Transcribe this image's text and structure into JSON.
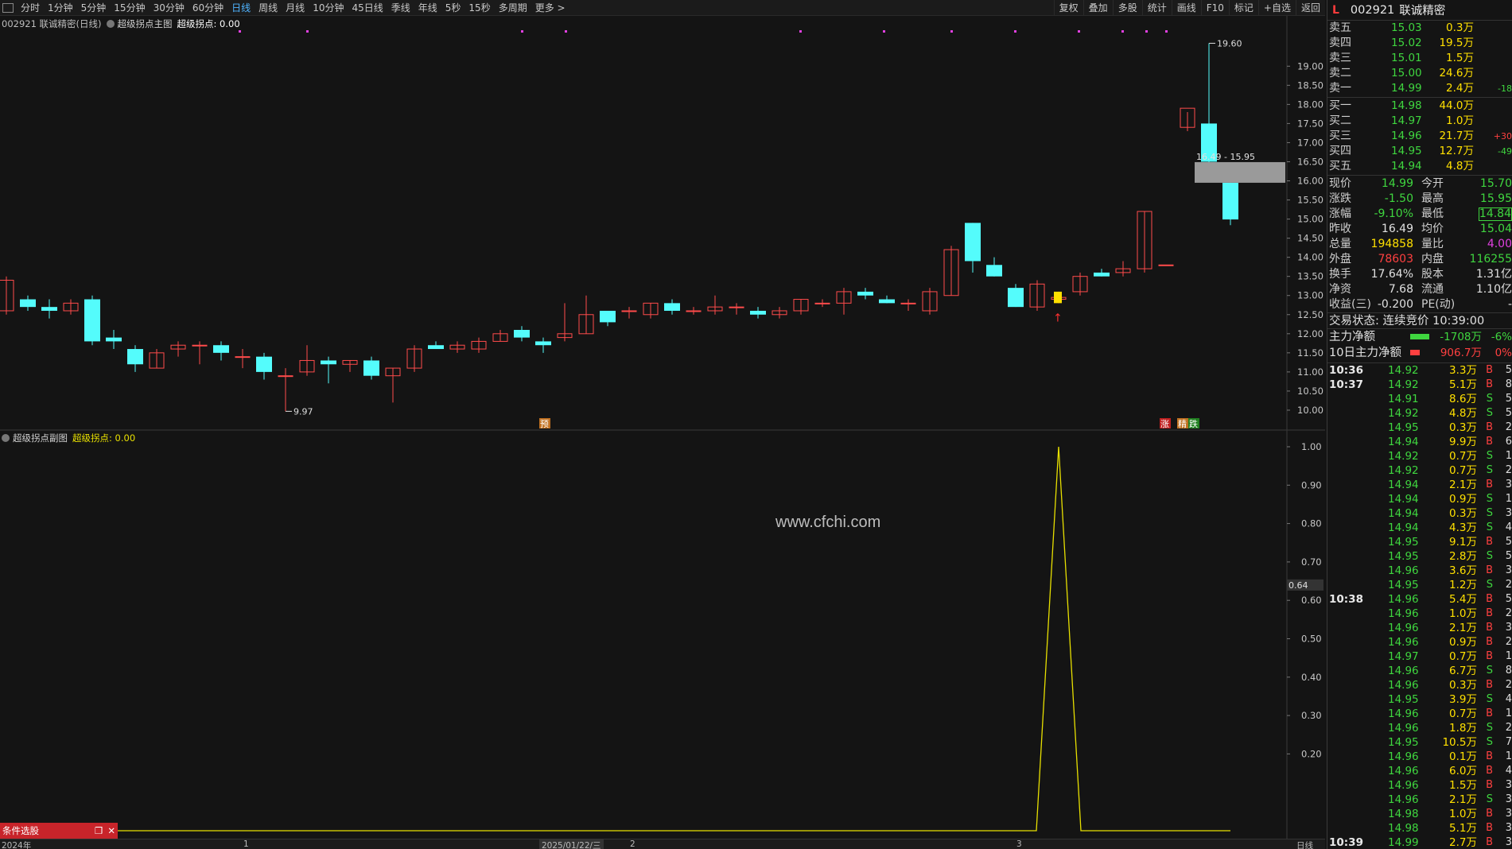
{
  "toolbar": {
    "periods": [
      "分时",
      "1分钟",
      "5分钟",
      "15分钟",
      "30分钟",
      "60分钟",
      "日线",
      "周线",
      "月线",
      "10分钟",
      "45日线",
      "季线",
      "年线",
      "5秒",
      "15秒",
      "多周期",
      "更多 >"
    ],
    "active_index": 6,
    "tools": [
      "复权",
      "叠加",
      "多股",
      "统计",
      "画线",
      "F10",
      "标记",
      "+自选",
      "返回"
    ]
  },
  "main": {
    "stock_label": "002921 联诚精密(日线)",
    "indicator_name": "超级拐点主图",
    "indicator_label": "超级拐点: 0.00",
    "price_axis": [
      "19.00",
      "18.50",
      "18.00",
      "17.50",
      "17.00",
      "16.50",
      "16.00",
      "15.50",
      "15.00",
      "14.50",
      "14.00",
      "13.50",
      "13.00",
      "12.50",
      "12.00",
      "11.50",
      "11.00",
      "10.50",
      "10.00"
    ],
    "high_label": "19.60",
    "low_label": "9.97",
    "gap_label": "16.49 - 15.95",
    "markers": [
      "预",
      "涨",
      "跌"
    ],
    "buy_marker": "精"
  },
  "sub": {
    "indicator_name": "超级拐点副图",
    "indicator_label": "超级拐点: 0.00",
    "axis": [
      "1.00",
      "0.90",
      "0.80",
      "0.70",
      "0.60",
      "0.50",
      "0.40",
      "0.30",
      "0.20"
    ],
    "cursor_value": "0.64"
  },
  "watermark": "www.cfchi.com",
  "condition_tab": "条件选股",
  "bottom_axis": {
    "year": "2024年",
    "m1": "1",
    "date": "2025/01/22/三",
    "m2": "2",
    "m3": "3",
    "period": "日线"
  },
  "chart_data": {
    "type": "candlestick",
    "ylim": [
      9.5,
      19.9
    ],
    "candles": [
      [
        12.6,
        13.5,
        12.5,
        13.4
      ],
      [
        12.9,
        13.0,
        12.6,
        12.7
      ],
      [
        12.7,
        12.9,
        12.4,
        12.6
      ],
      [
        12.6,
        12.9,
        12.5,
        12.8
      ],
      [
        12.9,
        13.0,
        11.7,
        11.8
      ],
      [
        11.9,
        12.1,
        11.6,
        11.8
      ],
      [
        11.6,
        11.7,
        11.0,
        11.2
      ],
      [
        11.1,
        11.6,
        11.1,
        11.5
      ],
      [
        11.6,
        11.8,
        11.4,
        11.7
      ],
      [
        11.7,
        11.8,
        11.2,
        11.7
      ],
      [
        11.7,
        11.8,
        11.3,
        11.5
      ],
      [
        11.4,
        11.6,
        11.1,
        11.4
      ],
      [
        11.4,
        11.5,
        10.8,
        11.0
      ],
      [
        10.9,
        11.1,
        9.97,
        10.9
      ],
      [
        11.0,
        11.7,
        10.9,
        11.3
      ],
      [
        11.3,
        11.4,
        10.7,
        11.2
      ],
      [
        11.2,
        11.3,
        11.0,
        11.3
      ],
      [
        11.3,
        11.4,
        10.8,
        10.9
      ],
      [
        10.9,
        11.1,
        10.2,
        11.1
      ],
      [
        11.1,
        11.7,
        11.0,
        11.6
      ],
      [
        11.7,
        11.8,
        11.6,
        11.6
      ],
      [
        11.6,
        11.8,
        11.5,
        11.7
      ],
      [
        11.6,
        11.9,
        11.5,
        11.8
      ],
      [
        11.8,
        12.1,
        11.8,
        12.0
      ],
      [
        12.1,
        12.2,
        11.8,
        11.9
      ],
      [
        11.8,
        11.9,
        11.5,
        11.7
      ],
      [
        11.9,
        12.8,
        11.8,
        12.0
      ],
      [
        12.0,
        13.0,
        12.0,
        12.5
      ],
      [
        12.6,
        12.6,
        12.2,
        12.3
      ],
      [
        12.6,
        12.7,
        12.4,
        12.6
      ],
      [
        12.5,
        12.8,
        12.4,
        12.8
      ],
      [
        12.8,
        12.9,
        12.5,
        12.6
      ],
      [
        12.6,
        12.7,
        12.5,
        12.6
      ],
      [
        12.6,
        13.0,
        12.5,
        12.7
      ],
      [
        12.7,
        12.8,
        12.5,
        12.7
      ],
      [
        12.6,
        12.7,
        12.4,
        12.5
      ],
      [
        12.5,
        12.7,
        12.4,
        12.6
      ],
      [
        12.6,
        12.9,
        12.5,
        12.9
      ],
      [
        12.8,
        12.9,
        12.7,
        12.8
      ],
      [
        12.8,
        13.2,
        12.5,
        13.1
      ],
      [
        13.1,
        13.2,
        12.9,
        13.0
      ],
      [
        12.9,
        13.0,
        12.8,
        12.8
      ],
      [
        12.8,
        12.9,
        12.6,
        12.8
      ],
      [
        12.6,
        13.2,
        12.5,
        13.1
      ],
      [
        13.0,
        14.3,
        13.0,
        14.2
      ],
      [
        14.9,
        14.9,
        13.6,
        13.9
      ],
      [
        13.8,
        14.0,
        13.5,
        13.5
      ],
      [
        13.2,
        13.3,
        12.7,
        12.7
      ],
      [
        12.7,
        13.4,
        12.6,
        13.3
      ],
      [
        12.9,
        13.1,
        12.8,
        12.95
      ],
      [
        13.1,
        13.6,
        13.0,
        13.5
      ],
      [
        13.6,
        13.7,
        13.5,
        13.5
      ],
      [
        13.6,
        13.9,
        13.5,
        13.7
      ],
      [
        13.7,
        15.2,
        13.6,
        15.2
      ],
      [
        13.8,
        13.8,
        13.8,
        13.8
      ],
      [
        17.4,
        17.8,
        17.3,
        17.9
      ],
      [
        17.5,
        19.6,
        16.4,
        16.5
      ],
      [
        15.95,
        15.95,
        14.84,
        14.99
      ]
    ]
  },
  "panel": {
    "code": "002921",
    "name": "联诚精密",
    "flag": "L",
    "asks": [
      {
        "label": "卖五",
        "price": "15.03",
        "vol": "0.3万",
        "chg": ""
      },
      {
        "label": "卖四",
        "price": "15.02",
        "vol": "19.5万",
        "chg": ""
      },
      {
        "label": "卖三",
        "price": "15.01",
        "vol": "1.5万",
        "chg": ""
      },
      {
        "label": "卖二",
        "price": "15.00",
        "vol": "24.6万",
        "chg": ""
      },
      {
        "label": "卖一",
        "price": "14.99",
        "vol": "2.4万",
        "chg": "-18"
      }
    ],
    "bids": [
      {
        "label": "买一",
        "price": "14.98",
        "vol": "44.0万",
        "chg": ""
      },
      {
        "label": "买二",
        "price": "14.97",
        "vol": "1.0万",
        "chg": ""
      },
      {
        "label": "买三",
        "price": "14.96",
        "vol": "21.7万",
        "chg": "+30"
      },
      {
        "label": "买四",
        "price": "14.95",
        "vol": "12.7万",
        "chg": "-49"
      },
      {
        "label": "买五",
        "price": "14.94",
        "vol": "4.8万",
        "chg": ""
      }
    ],
    "quote": [
      {
        "a": "现价",
        "av": "14.99",
        "ac": "#3fd63f",
        "b": "今开",
        "bv": "15.70",
        "bc": "#3fd63f"
      },
      {
        "a": "涨跌",
        "av": "-1.50",
        "ac": "#3fd63f",
        "b": "最高",
        "bv": "15.95",
        "bc": "#3fd63f"
      },
      {
        "a": "涨幅",
        "av": "-9.10%",
        "ac": "#3fd63f",
        "b": "最低",
        "bv": "14.84",
        "bc": "#3fd63f"
      },
      {
        "a": "昨收",
        "av": "16.49",
        "ac": "#e0e0e0",
        "b": "均价",
        "bv": "15.04",
        "bc": "#3fd63f"
      },
      {
        "a": "总量",
        "av": "194858",
        "ac": "#ffe000",
        "b": "量比",
        "bv": "4.00",
        "bc": "#e040e0"
      },
      {
        "a": "外盘",
        "av": "78603",
        "ac": "#ff4040",
        "b": "内盘",
        "bv": "116255",
        "bc": "#3fd63f"
      },
      {
        "a": "换手",
        "av": "17.64%",
        "ac": "#e0e0e0",
        "b": "股本",
        "bv": "1.31亿",
        "bc": "#e0e0e0"
      },
      {
        "a": "净资",
        "av": "7.68",
        "ac": "#e0e0e0",
        "b": "流通",
        "bv": "1.10亿",
        "bc": "#e0e0e0"
      },
      {
        "a": "收益(三)",
        "av": "-0.200",
        "ac": "#e0e0e0",
        "b": "PE(动)",
        "bv": "-",
        "bc": "#e0e0e0"
      }
    ],
    "status": "交易状态: 连续竞价 10:39:00",
    "flow1": {
      "label": "主力净额",
      "value": "-1708万",
      "pct": "-6%",
      "color": "#3fd63f"
    },
    "flow2": {
      "label": "10日主力净额",
      "value": "906.7万",
      "pct": "0%",
      "color": "#ff4040"
    },
    "ticks": [
      {
        "t": "10:36",
        "p": "14.92",
        "v": "3.3万",
        "bs": "B",
        "n": "5"
      },
      {
        "t": "10:37",
        "p": "14.92",
        "v": "5.1万",
        "bs": "B",
        "n": "8"
      },
      {
        "t": "",
        "p": "14.91",
        "v": "8.6万",
        "bs": "S",
        "n": "5"
      },
      {
        "t": "",
        "p": "14.92",
        "v": "4.8万",
        "bs": "S",
        "n": "5"
      },
      {
        "t": "",
        "p": "14.95",
        "v": "0.3万",
        "bs": "B",
        "n": "2"
      },
      {
        "t": "",
        "p": "14.94",
        "v": "9.9万",
        "bs": "B",
        "n": "6"
      },
      {
        "t": "",
        "p": "14.92",
        "v": "0.7万",
        "bs": "S",
        "n": "1"
      },
      {
        "t": "",
        "p": "14.92",
        "v": "0.7万",
        "bs": "S",
        "n": "2"
      },
      {
        "t": "",
        "p": "14.94",
        "v": "2.1万",
        "bs": "B",
        "n": "3"
      },
      {
        "t": "",
        "p": "14.94",
        "v": "0.9万",
        "bs": "S",
        "n": "1"
      },
      {
        "t": "",
        "p": "14.94",
        "v": "0.3万",
        "bs": "S",
        "n": "3"
      },
      {
        "t": "",
        "p": "14.94",
        "v": "4.3万",
        "bs": "S",
        "n": "4"
      },
      {
        "t": "",
        "p": "14.95",
        "v": "9.1万",
        "bs": "B",
        "n": "5"
      },
      {
        "t": "",
        "p": "14.95",
        "v": "2.8万",
        "bs": "S",
        "n": "5"
      },
      {
        "t": "",
        "p": "14.96",
        "v": "3.6万",
        "bs": "B",
        "n": "3"
      },
      {
        "t": "",
        "p": "14.95",
        "v": "1.2万",
        "bs": "S",
        "n": "2"
      },
      {
        "t": "10:38",
        "p": "14.96",
        "v": "5.4万",
        "bs": "B",
        "n": "5"
      },
      {
        "t": "",
        "p": "14.96",
        "v": "1.0万",
        "bs": "B",
        "n": "2"
      },
      {
        "t": "",
        "p": "14.96",
        "v": "2.1万",
        "bs": "B",
        "n": "3"
      },
      {
        "t": "",
        "p": "14.96",
        "v": "0.9万",
        "bs": "B",
        "n": "2"
      },
      {
        "t": "",
        "p": "14.97",
        "v": "0.7万",
        "bs": "B",
        "n": "1"
      },
      {
        "t": "",
        "p": "14.96",
        "v": "6.7万",
        "bs": "S",
        "n": "8"
      },
      {
        "t": "",
        "p": "14.96",
        "v": "0.3万",
        "bs": "B",
        "n": "2"
      },
      {
        "t": "",
        "p": "14.95",
        "v": "3.9万",
        "bs": "S",
        "n": "4"
      },
      {
        "t": "",
        "p": "14.96",
        "v": "0.7万",
        "bs": "B",
        "n": "1"
      },
      {
        "t": "",
        "p": "14.96",
        "v": "1.8万",
        "bs": "S",
        "n": "2"
      },
      {
        "t": "",
        "p": "14.95",
        "v": "10.5万",
        "bs": "S",
        "n": "7"
      },
      {
        "t": "",
        "p": "14.96",
        "v": "0.1万",
        "bs": "B",
        "n": "1"
      },
      {
        "t": "",
        "p": "14.96",
        "v": "6.0万",
        "bs": "B",
        "n": "4"
      },
      {
        "t": "",
        "p": "14.96",
        "v": "1.5万",
        "bs": "B",
        "n": "3"
      },
      {
        "t": "",
        "p": "14.96",
        "v": "2.1万",
        "bs": "S",
        "n": "3"
      },
      {
        "t": "",
        "p": "14.98",
        "v": "1.0万",
        "bs": "B",
        "n": "3"
      },
      {
        "t": "",
        "p": "14.98",
        "v": "5.1万",
        "bs": "B",
        "n": "3"
      },
      {
        "t": "10:39",
        "p": "14.99",
        "v": "2.7万",
        "bs": "B",
        "n": "3"
      }
    ]
  },
  "colors": {
    "up": "#ff4b4b",
    "down": "#54fcfc",
    "indicator": "#e8e000",
    "bg": "#141414"
  }
}
